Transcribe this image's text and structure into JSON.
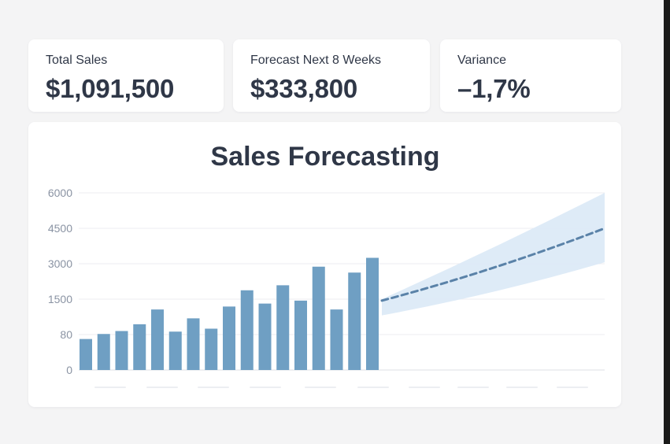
{
  "kpis": [
    {
      "label": "Total Sales",
      "value": "$1,091,500"
    },
    {
      "label": "Forecast Next 8 Weeks",
      "value": "$333,800"
    },
    {
      "label": "Variance",
      "value": "–1,7%"
    }
  ],
  "colors": {
    "bar": "#6f9fc3",
    "forecast_line": "#5a82a8",
    "forecast_band": "#dceaf7",
    "grid": "#ececf0",
    "axis_text": "#8a93a3",
    "title": "#2f3747"
  },
  "chart_data": {
    "type": "bar",
    "title": "Sales Forecasting",
    "xlabel": "",
    "ylabel": "",
    "y_ticks": [
      "6000",
      "4500",
      "3000",
      "1500",
      "80",
      "0"
    ],
    "grid": true,
    "series": [
      {
        "kind": "bar",
        "values": [
          1050,
          1220,
          1320,
          1550,
          2050,
          1300,
          1750,
          1400,
          2150,
          2700,
          2250,
          2870,
          2350,
          3500,
          2050,
          3300,
          3800
        ]
      },
      {
        "kind": "line",
        "style": "dashed",
        "x_weeks_after_last_bar": [
          0,
          4,
          8
        ],
        "values": [
          2350,
          3350,
          4800
        ],
        "band_upper": [
          2400,
          4100,
          6000
        ],
        "band_lower": [
          1850,
          2550,
          3650
        ]
      }
    ]
  }
}
